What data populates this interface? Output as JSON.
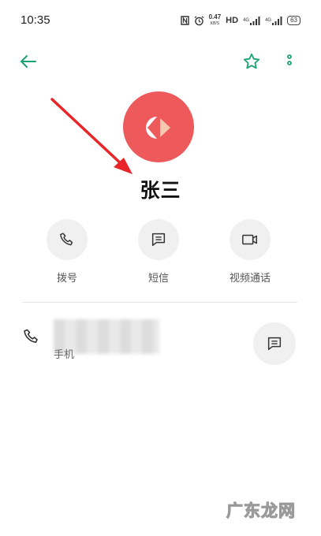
{
  "status_bar": {
    "time": "10:35",
    "net_speed": "0.47",
    "net_unit": "KB/S",
    "hd_label": "HD",
    "sig1_label": "4G",
    "sig2_label": "4G",
    "battery": "63"
  },
  "top_bar": {
    "back_icon": "arrow-left-icon",
    "favorite_icon": "star-outline-icon",
    "more_icon": "more-vertical-icon",
    "accent_color": "#1aa36f"
  },
  "contact": {
    "name": "张三",
    "avatar_color": "#ee5a5c"
  },
  "actions": {
    "call_label": "拨号",
    "sms_label": "短信",
    "video_label": "视频通话"
  },
  "phone_entry": {
    "type_label": "手机"
  },
  "watermark": "广东龙网"
}
